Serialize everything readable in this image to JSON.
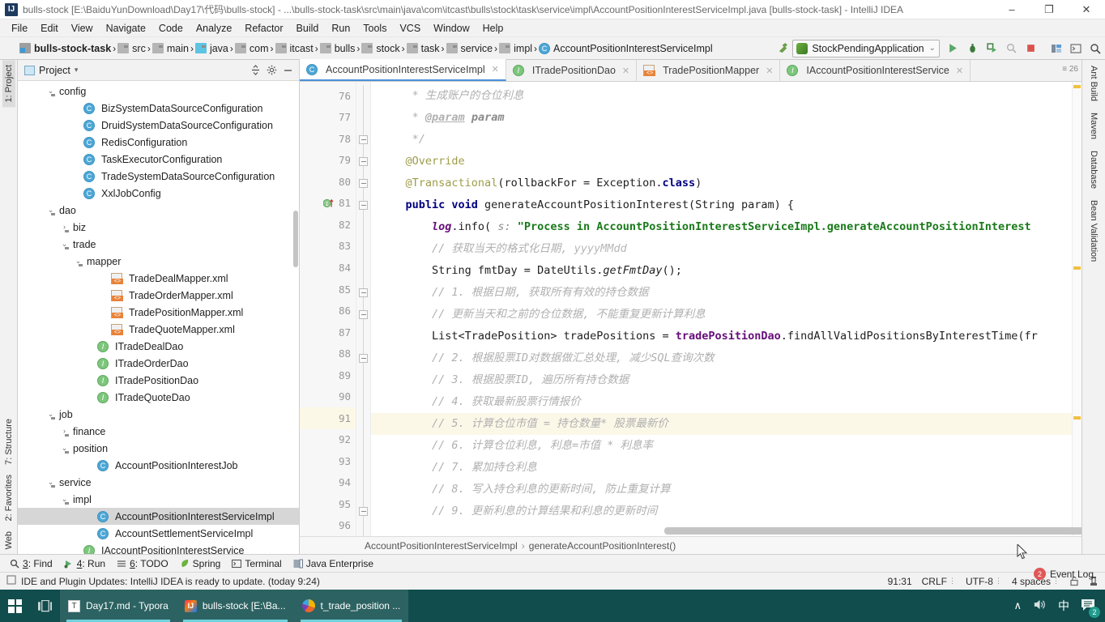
{
  "window": {
    "title": "bulls-stock [E:\\BaiduYunDownload\\Day17\\代码\\bulls-stock] - ...\\bulls-stock-task\\src\\main\\java\\com\\itcast\\bulls\\stock\\task\\service\\impl\\AccountPositionInterestServiceImpl.java [bulls-stock-task] - IntelliJ IDEA",
    "app_badge": "IJ",
    "minimize": "–",
    "maximize": "❐",
    "close": "✕"
  },
  "menubar": [
    "File",
    "Edit",
    "View",
    "Navigate",
    "Code",
    "Analyze",
    "Refactor",
    "Build",
    "Run",
    "Tools",
    "VCS",
    "Window",
    "Help"
  ],
  "navbar": {
    "crumbs": [
      {
        "label": "bulls-stock-task",
        "icon": "module-icon",
        "bold": true
      },
      {
        "label": "src",
        "icon": "folder-icon",
        "bold": false
      },
      {
        "label": "main",
        "icon": "folder-icon",
        "bold": false
      },
      {
        "label": "java",
        "icon": "folder-blue-icon",
        "bold": false
      },
      {
        "label": "com",
        "icon": "folder-icon",
        "bold": false
      },
      {
        "label": "itcast",
        "icon": "folder-icon",
        "bold": false
      },
      {
        "label": "bulls",
        "icon": "folder-icon",
        "bold": false
      },
      {
        "label": "stock",
        "icon": "folder-icon",
        "bold": false
      },
      {
        "label": "task",
        "icon": "folder-icon",
        "bold": false
      },
      {
        "label": "service",
        "icon": "folder-icon",
        "bold": false
      },
      {
        "label": "impl",
        "icon": "folder-icon",
        "bold": false
      },
      {
        "label": "AccountPositionInterestServiceImpl",
        "icon": "class-icon",
        "bold": false
      }
    ],
    "run_config": "StockPendingApplication",
    "run_config_caret": "⌄",
    "buttons": [
      "run-button",
      "debug-button",
      "run-coverage-button",
      "profile-button",
      "stop-button",
      "build-button",
      "terminal-button",
      "search-everywhere-button"
    ]
  },
  "left_stripe": {
    "top": [
      "1: Project"
    ],
    "bottom": [
      "7: Structure",
      "2: Favorites",
      "Web"
    ]
  },
  "right_stripe": [
    "Ant Build",
    "Maven",
    "Database",
    "Bean Validation"
  ],
  "project_panel": {
    "title": "Project",
    "title_caret": "▾",
    "buttons": [
      "collapse-all-button",
      "settings-button",
      "hide-button"
    ],
    "tree": [
      {
        "indent": 2,
        "twist": "⌄",
        "icon": "folder-icon",
        "label": "config",
        "selected": false
      },
      {
        "indent": 4,
        "twist": "",
        "icon": "class-icon",
        "label": "BizSystemDataSourceConfiguration",
        "selected": false
      },
      {
        "indent": 4,
        "twist": "",
        "icon": "class-icon",
        "label": "DruidSystemDataSourceConfiguration",
        "selected": false
      },
      {
        "indent": 4,
        "twist": "",
        "icon": "class-icon",
        "label": "RedisConfiguration",
        "selected": false
      },
      {
        "indent": 4,
        "twist": "",
        "icon": "class-icon",
        "label": "TaskExecutorConfiguration",
        "selected": false
      },
      {
        "indent": 4,
        "twist": "",
        "icon": "class-icon",
        "label": "TradeSystemDataSourceConfiguration",
        "selected": false
      },
      {
        "indent": 4,
        "twist": "",
        "icon": "class-icon",
        "label": "XxlJobConfig",
        "selected": false
      },
      {
        "indent": 2,
        "twist": "⌄",
        "icon": "folder-icon",
        "label": "dao",
        "selected": false
      },
      {
        "indent": 3,
        "twist": "›",
        "icon": "folder-icon",
        "label": "biz",
        "selected": false
      },
      {
        "indent": 3,
        "twist": "⌄",
        "icon": "folder-icon",
        "label": "trade",
        "selected": false
      },
      {
        "indent": 4,
        "twist": "⌄",
        "icon": "folder-icon",
        "label": "mapper",
        "selected": false
      },
      {
        "indent": 6,
        "twist": "",
        "icon": "xml-icon",
        "label": "TradeDealMapper.xml",
        "selected": false
      },
      {
        "indent": 6,
        "twist": "",
        "icon": "xml-icon",
        "label": "TradeOrderMapper.xml",
        "selected": false
      },
      {
        "indent": 6,
        "twist": "",
        "icon": "xml-icon",
        "label": "TradePositionMapper.xml",
        "selected": false
      },
      {
        "indent": 6,
        "twist": "",
        "icon": "xml-icon",
        "label": "TradeQuoteMapper.xml",
        "selected": false
      },
      {
        "indent": 5,
        "twist": "",
        "icon": "interface-icon",
        "label": "ITradeDealDao",
        "selected": false
      },
      {
        "indent": 5,
        "twist": "",
        "icon": "interface-icon",
        "label": "ITradeOrderDao",
        "selected": false
      },
      {
        "indent": 5,
        "twist": "",
        "icon": "interface-icon",
        "label": "ITradePositionDao",
        "selected": false
      },
      {
        "indent": 5,
        "twist": "",
        "icon": "interface-icon",
        "label": "ITradeQuoteDao",
        "selected": false
      },
      {
        "indent": 2,
        "twist": "⌄",
        "icon": "folder-icon",
        "label": "job",
        "selected": false
      },
      {
        "indent": 3,
        "twist": "›",
        "icon": "folder-icon",
        "label": "finance",
        "selected": false
      },
      {
        "indent": 3,
        "twist": "⌄",
        "icon": "folder-icon",
        "label": "position",
        "selected": false
      },
      {
        "indent": 5,
        "twist": "",
        "icon": "class-icon",
        "label": "AccountPositionInterestJob",
        "selected": false
      },
      {
        "indent": 2,
        "twist": "⌄",
        "icon": "folder-icon",
        "label": "service",
        "selected": false
      },
      {
        "indent": 3,
        "twist": "⌄",
        "icon": "folder-icon",
        "label": "impl",
        "selected": false
      },
      {
        "indent": 5,
        "twist": "",
        "icon": "class-icon",
        "label": "AccountPositionInterestServiceImpl",
        "selected": true
      },
      {
        "indent": 5,
        "twist": "",
        "icon": "class-icon",
        "label": "AccountSettlementServiceImpl",
        "selected": false
      },
      {
        "indent": 4,
        "twist": "",
        "icon": "interface-icon",
        "label": "IAccountPositionInterestService",
        "selected": false
      }
    ]
  },
  "editor": {
    "tabs": [
      {
        "label": "AccountPositionInterestServiceImpl",
        "icon": "class-icon",
        "active": true,
        "close": "✕"
      },
      {
        "label": "ITradePositionDao",
        "icon": "interface-icon",
        "active": false,
        "close": "✕"
      },
      {
        "label": "TradePositionMapper",
        "icon": "xml-icon",
        "active": false,
        "close": "✕"
      },
      {
        "label": "IAccountPositionInterestService",
        "icon": "interface-icon",
        "active": false,
        "close": "✕"
      }
    ],
    "tab_overflow": "≡ 26",
    "lines": [
      {
        "n": 76,
        "fold": "",
        "hl": false,
        "tokens": [
          {
            "t": "cm",
            "v": "     * 生成账户的仓位利息"
          }
        ]
      },
      {
        "n": 77,
        "fold": "",
        "hl": false,
        "tokens": [
          {
            "t": "cm",
            "v": "     * "
          },
          {
            "t": "cmlink",
            "v": "@param"
          },
          {
            "t": "cmb",
            "v": " param"
          }
        ]
      },
      {
        "n": 78,
        "fold": "box",
        "hl": false,
        "tokens": [
          {
            "t": "cm",
            "v": "     */"
          }
        ]
      },
      {
        "n": 79,
        "fold": "box",
        "hl": false,
        "tokens": [
          {
            "t": "ann",
            "v": "    @Override"
          }
        ]
      },
      {
        "n": 80,
        "fold": "box",
        "hl": false,
        "tokens": [
          {
            "t": "ann",
            "v": "    @Transactional"
          },
          {
            "t": "plain",
            "v": "(rollbackFor = Exception."
          },
          {
            "t": "kw",
            "v": "class"
          },
          {
            "t": "plain",
            "v": ")"
          }
        ]
      },
      {
        "n": 81,
        "fold": "box",
        "hl": false,
        "gutter_icon": "implementing-method-icon",
        "tokens": [
          {
            "t": "kw",
            "v": "    public void "
          },
          {
            "t": "plain",
            "v": "generateAccountPositionInterest(String param) {"
          }
        ]
      },
      {
        "n": 82,
        "fold": "",
        "hl": false,
        "tokens": [
          {
            "t": "fld",
            "v": "        log"
          },
          {
            "t": "plain",
            "v": ".info("
          },
          {
            "t": "hint",
            "v": " s:"
          },
          {
            "t": "str",
            "v": " \"Process in AccountPositionInterestServiceImpl.generateAccountPositionInterest"
          }
        ]
      },
      {
        "n": 83,
        "fold": "",
        "hl": false,
        "tokens": [
          {
            "t": "cm",
            "v": "        // 获取当天的格式化日期,"
          },
          {
            "t": "cmz",
            "v": " yyyyMMdd"
          }
        ]
      },
      {
        "n": 84,
        "fold": "",
        "hl": false,
        "tokens": [
          {
            "t": "plain",
            "v": "        String fmtDay = DateUtils."
          },
          {
            "t": "mth",
            "v": "getFmtDay"
          },
          {
            "t": "plain",
            "v": "();"
          }
        ]
      },
      {
        "n": 85,
        "fold": "box",
        "hl": false,
        "tokens": [
          {
            "t": "cm",
            "v": "        // 1. 根据日期, 获取所有有效的持仓数据"
          }
        ]
      },
      {
        "n": 86,
        "fold": "box",
        "hl": false,
        "tokens": [
          {
            "t": "cm",
            "v": "        // 更新当天和之前的仓位数据, 不能重复更新计算利息"
          }
        ]
      },
      {
        "n": 87,
        "fold": "",
        "hl": false,
        "tokens": [
          {
            "t": "plain",
            "v": "        List<TradePosition> tradePositions = "
          },
          {
            "t": "var",
            "v": "tradePositionDao"
          },
          {
            "t": "plain",
            "v": ".findAllValidPositionsByInterestTime(fr"
          }
        ]
      },
      {
        "n": 88,
        "fold": "box",
        "hl": false,
        "tokens": [
          {
            "t": "cm",
            "v": "        // 2. 根据股票ID对数据做汇总处理, 减少SQL查询次数"
          }
        ]
      },
      {
        "n": 89,
        "fold": "",
        "hl": false,
        "tokens": [
          {
            "t": "cm",
            "v": "        // 3. 根据股票ID, 遍历所有持仓数据"
          }
        ]
      },
      {
        "n": 90,
        "fold": "",
        "hl": false,
        "tokens": [
          {
            "t": "cm",
            "v": "        // 4. 获取最新股票行情报价"
          }
        ]
      },
      {
        "n": 91,
        "fold": "",
        "hl": true,
        "tokens": [
          {
            "t": "cm",
            "v": "        // 5. 计算仓位市值 = 持仓数量* 股票最新价"
          }
        ]
      },
      {
        "n": 92,
        "fold": "",
        "hl": false,
        "tokens": [
          {
            "t": "cm",
            "v": "        // 6. 计算仓位利息, 利息=市值 * 利息率"
          }
        ]
      },
      {
        "n": 93,
        "fold": "",
        "hl": false,
        "tokens": [
          {
            "t": "cm",
            "v": "        // 7. 累加持仓利息"
          }
        ]
      },
      {
        "n": 94,
        "fold": "",
        "hl": false,
        "tokens": [
          {
            "t": "cm",
            "v": "        // 8. 写入持仓利息的更新时间, 防止重复计算"
          }
        ]
      },
      {
        "n": 95,
        "fold": "box",
        "hl": false,
        "tokens": [
          {
            "t": "cm",
            "v": "        // 9. 更新利息的计算结果和利息的更新时间"
          }
        ]
      },
      {
        "n": 96,
        "fold": "",
        "hl": false,
        "tokens": [
          {
            "t": "plain",
            "v": ""
          }
        ]
      }
    ],
    "breadcrumbs": [
      "AccountPositionInterestServiceImpl",
      "generateAccountPositionInterest()"
    ],
    "breadcrumb_sep": "›"
  },
  "bottom_toolbar": [
    {
      "num": "3",
      "label": ": Find",
      "icon": "search-icon"
    },
    {
      "num": "4",
      "label": ": Run",
      "icon": "play-icon"
    },
    {
      "num": "6",
      "label": ": TODO",
      "icon": "list-icon"
    },
    {
      "num": "",
      "label": "Spring",
      "icon": "spring-leaf-icon"
    },
    {
      "num": "",
      "label": "Terminal",
      "icon": "terminal-icon"
    },
    {
      "num": "",
      "label": "Java Enterprise",
      "icon": "java-enterprise-icon"
    }
  ],
  "statusbar": {
    "message": "IDE and Plugin Updates: IntelliJ IDEA is ready to update. (today 9:24)",
    "position": "91:31",
    "line_separator": "CRLF",
    "encoding": "UTF-8",
    "indent": "4 spaces",
    "caret": "⫷⫶",
    "lock_icon": "lock-icon",
    "inspector_icon": "inspection-icon"
  },
  "event_log": {
    "label": "Event Log",
    "count": "2"
  },
  "taskbar": {
    "start": "start-button",
    "taskview": "task-view-button",
    "items": [
      {
        "label": "Day17.md - Typora",
        "icon": "typora-icon",
        "active": true
      },
      {
        "label": "bulls-stock [E:\\Ba...",
        "icon": "intellij-icon",
        "active": true
      },
      {
        "label": "t_trade_position ...",
        "icon": "navicat-icon",
        "active": true
      }
    ],
    "tray": {
      "chevron": "∧",
      "volume": "🔊",
      "ime": "中",
      "notifications_count": "2"
    }
  }
}
